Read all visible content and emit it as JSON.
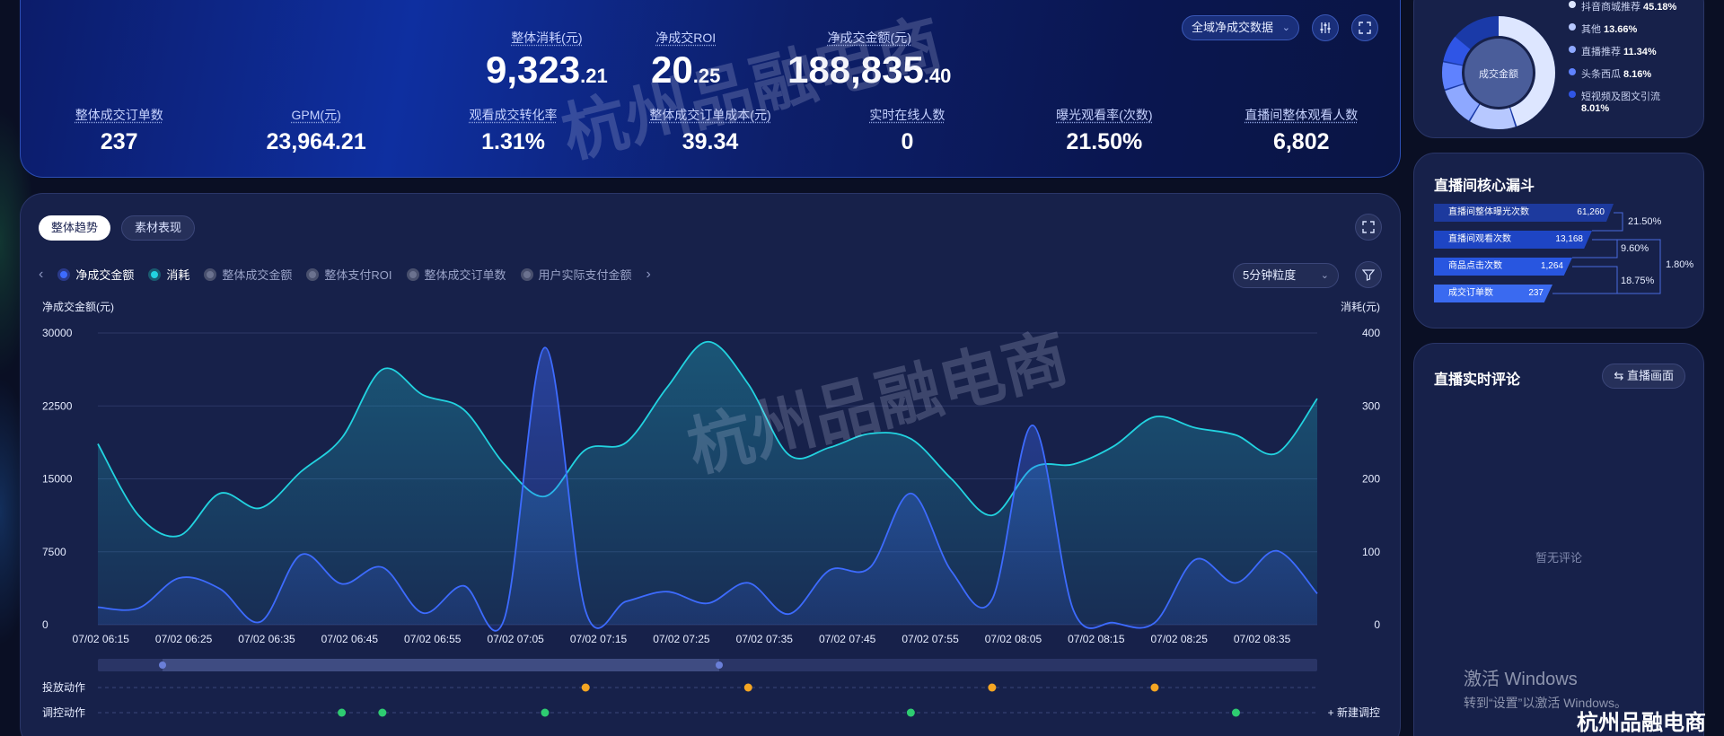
{
  "kpi": {
    "main": [
      {
        "label": "整体消耗(元)",
        "int": "9,323",
        "dec": ".21"
      },
      {
        "label": "净成交ROI",
        "int": "20",
        "dec": ".25"
      },
      {
        "label": "净成交金额(元)",
        "int": "188,835",
        "dec": ".40"
      }
    ],
    "sub": [
      {
        "label": "整体成交订单数",
        "value": "237"
      },
      {
        "label": "GPM(元)",
        "value": "23,964.21"
      },
      {
        "label": "观看成交转化率",
        "value": "1.31%"
      },
      {
        "label": "整体成交订单成本(元)",
        "value": "39.34"
      },
      {
        "label": "实时在线人数",
        "value": "0"
      },
      {
        "label": "曝光观看率(次数)",
        "value": "21.50%"
      },
      {
        "label": "直播间整体观看人数",
        "value": "6,802"
      }
    ],
    "scope_select": "全域净成交数据",
    "icons": [
      "sliders-icon",
      "fullscreen-icon"
    ]
  },
  "trend": {
    "tabs": [
      "整体趋势",
      "素材表现"
    ],
    "legend": [
      {
        "label": "净成交金额",
        "on": true,
        "color": "#3d6bff"
      },
      {
        "label": "消耗",
        "on": true,
        "color": "#22d3e0"
      },
      {
        "label": "整体成交金额",
        "on": false
      },
      {
        "label": "整体支付ROI",
        "on": false
      },
      {
        "label": "整体成交订单数",
        "on": false
      },
      {
        "label": "用户实际支付金额",
        "on": false
      }
    ],
    "granularity": "5分钟粒度",
    "action_rows": [
      "投放动作",
      "调控动作"
    ],
    "new_control": "新建调控"
  },
  "chart_data": {
    "type": "line",
    "ylabel": "净成交金额(元)",
    "y2label": "消耗(元)",
    "ylim": [
      0,
      30000
    ],
    "y2lim": [
      0,
      400
    ],
    "y_ticks": [
      "0",
      "7500",
      "15000",
      "22500",
      "30000"
    ],
    "y2_ticks": [
      "0",
      "100",
      "200",
      "300",
      "400"
    ],
    "x_ticks": [
      "07/02 06:15",
      "07/02 06:25",
      "07/02 06:35",
      "07/02 06:45",
      "07/02 06:55",
      "07/02 07:05",
      "07/02 07:15",
      "07/02 07:25",
      "07/02 07:35",
      "07/02 07:45",
      "07/02 07:55",
      "07/02 08:05",
      "07/02 08:15",
      "07/02 08:25",
      "07/02 08:35"
    ],
    "series": [
      {
        "name": "净成交金额",
        "axis": "left",
        "color": "#3d6bff",
        "values": [
          1800,
          1700,
          4800,
          3700,
          300,
          7200,
          4200,
          5900,
          1200,
          4000,
          600,
          28500,
          1400,
          2400,
          3400,
          2200,
          4300,
          1100,
          5600,
          5900,
          13500,
          5500,
          2600,
          20500,
          1500,
          200,
          200,
          6700,
          4300,
          7600,
          3200
        ]
      },
      {
        "name": "消耗",
        "axis": "right",
        "color": "#22d3e0",
        "values": [
          248,
          150,
          122,
          180,
          160,
          210,
          256,
          350,
          315,
          295,
          220,
          176,
          240,
          250,
          325,
          388,
          330,
          233,
          243,
          262,
          255,
          200,
          150,
          215,
          220,
          245,
          285,
          270,
          260,
          235,
          310
        ]
      }
    ],
    "launch_actions": [
      12,
      16,
      22,
      26
    ],
    "control_actions": [
      6,
      7,
      11,
      20,
      28
    ]
  },
  "donut": {
    "center": "成交金额",
    "items": [
      {
        "label": "抖音商城推荐",
        "pct": "45.18%",
        "value": 45.18,
        "color": "#dde6ff"
      },
      {
        "label": "其他",
        "pct": "13.66%",
        "value": 13.66,
        "color": "#b7c8ff"
      },
      {
        "label": "直播推荐",
        "pct": "11.34%",
        "value": 11.34,
        "color": "#8ea8ff"
      },
      {
        "label": "头条西瓜",
        "pct": "8.16%",
        "value": 8.16,
        "color": "#5f82ff"
      },
      {
        "label": "短视频及图文引流",
        "pct": "8.01%",
        "value": 8.01,
        "color": "#2f55e6"
      }
    ]
  },
  "funnel": {
    "title": "直播间核心漏斗",
    "steps": [
      {
        "label": "直播间整体曝光次数",
        "value": "61,260"
      },
      {
        "label": "直播间观看次数",
        "value": "13,168"
      },
      {
        "label": "商品点击次数",
        "value": "1,264"
      },
      {
        "label": "成交订单数",
        "value": "237"
      }
    ],
    "rates": [
      "21.50%",
      "9.60%",
      "18.75%"
    ],
    "overall": "1.80%"
  },
  "comments": {
    "title": "直播实时评论",
    "button": "直播画面",
    "empty": "暂无评论"
  },
  "watermark": "杭州品融电商",
  "windows": {
    "line1": "激活 Windows",
    "line2": "转到“设置”以激活 Windows。"
  },
  "corner": "杭州品融电商"
}
